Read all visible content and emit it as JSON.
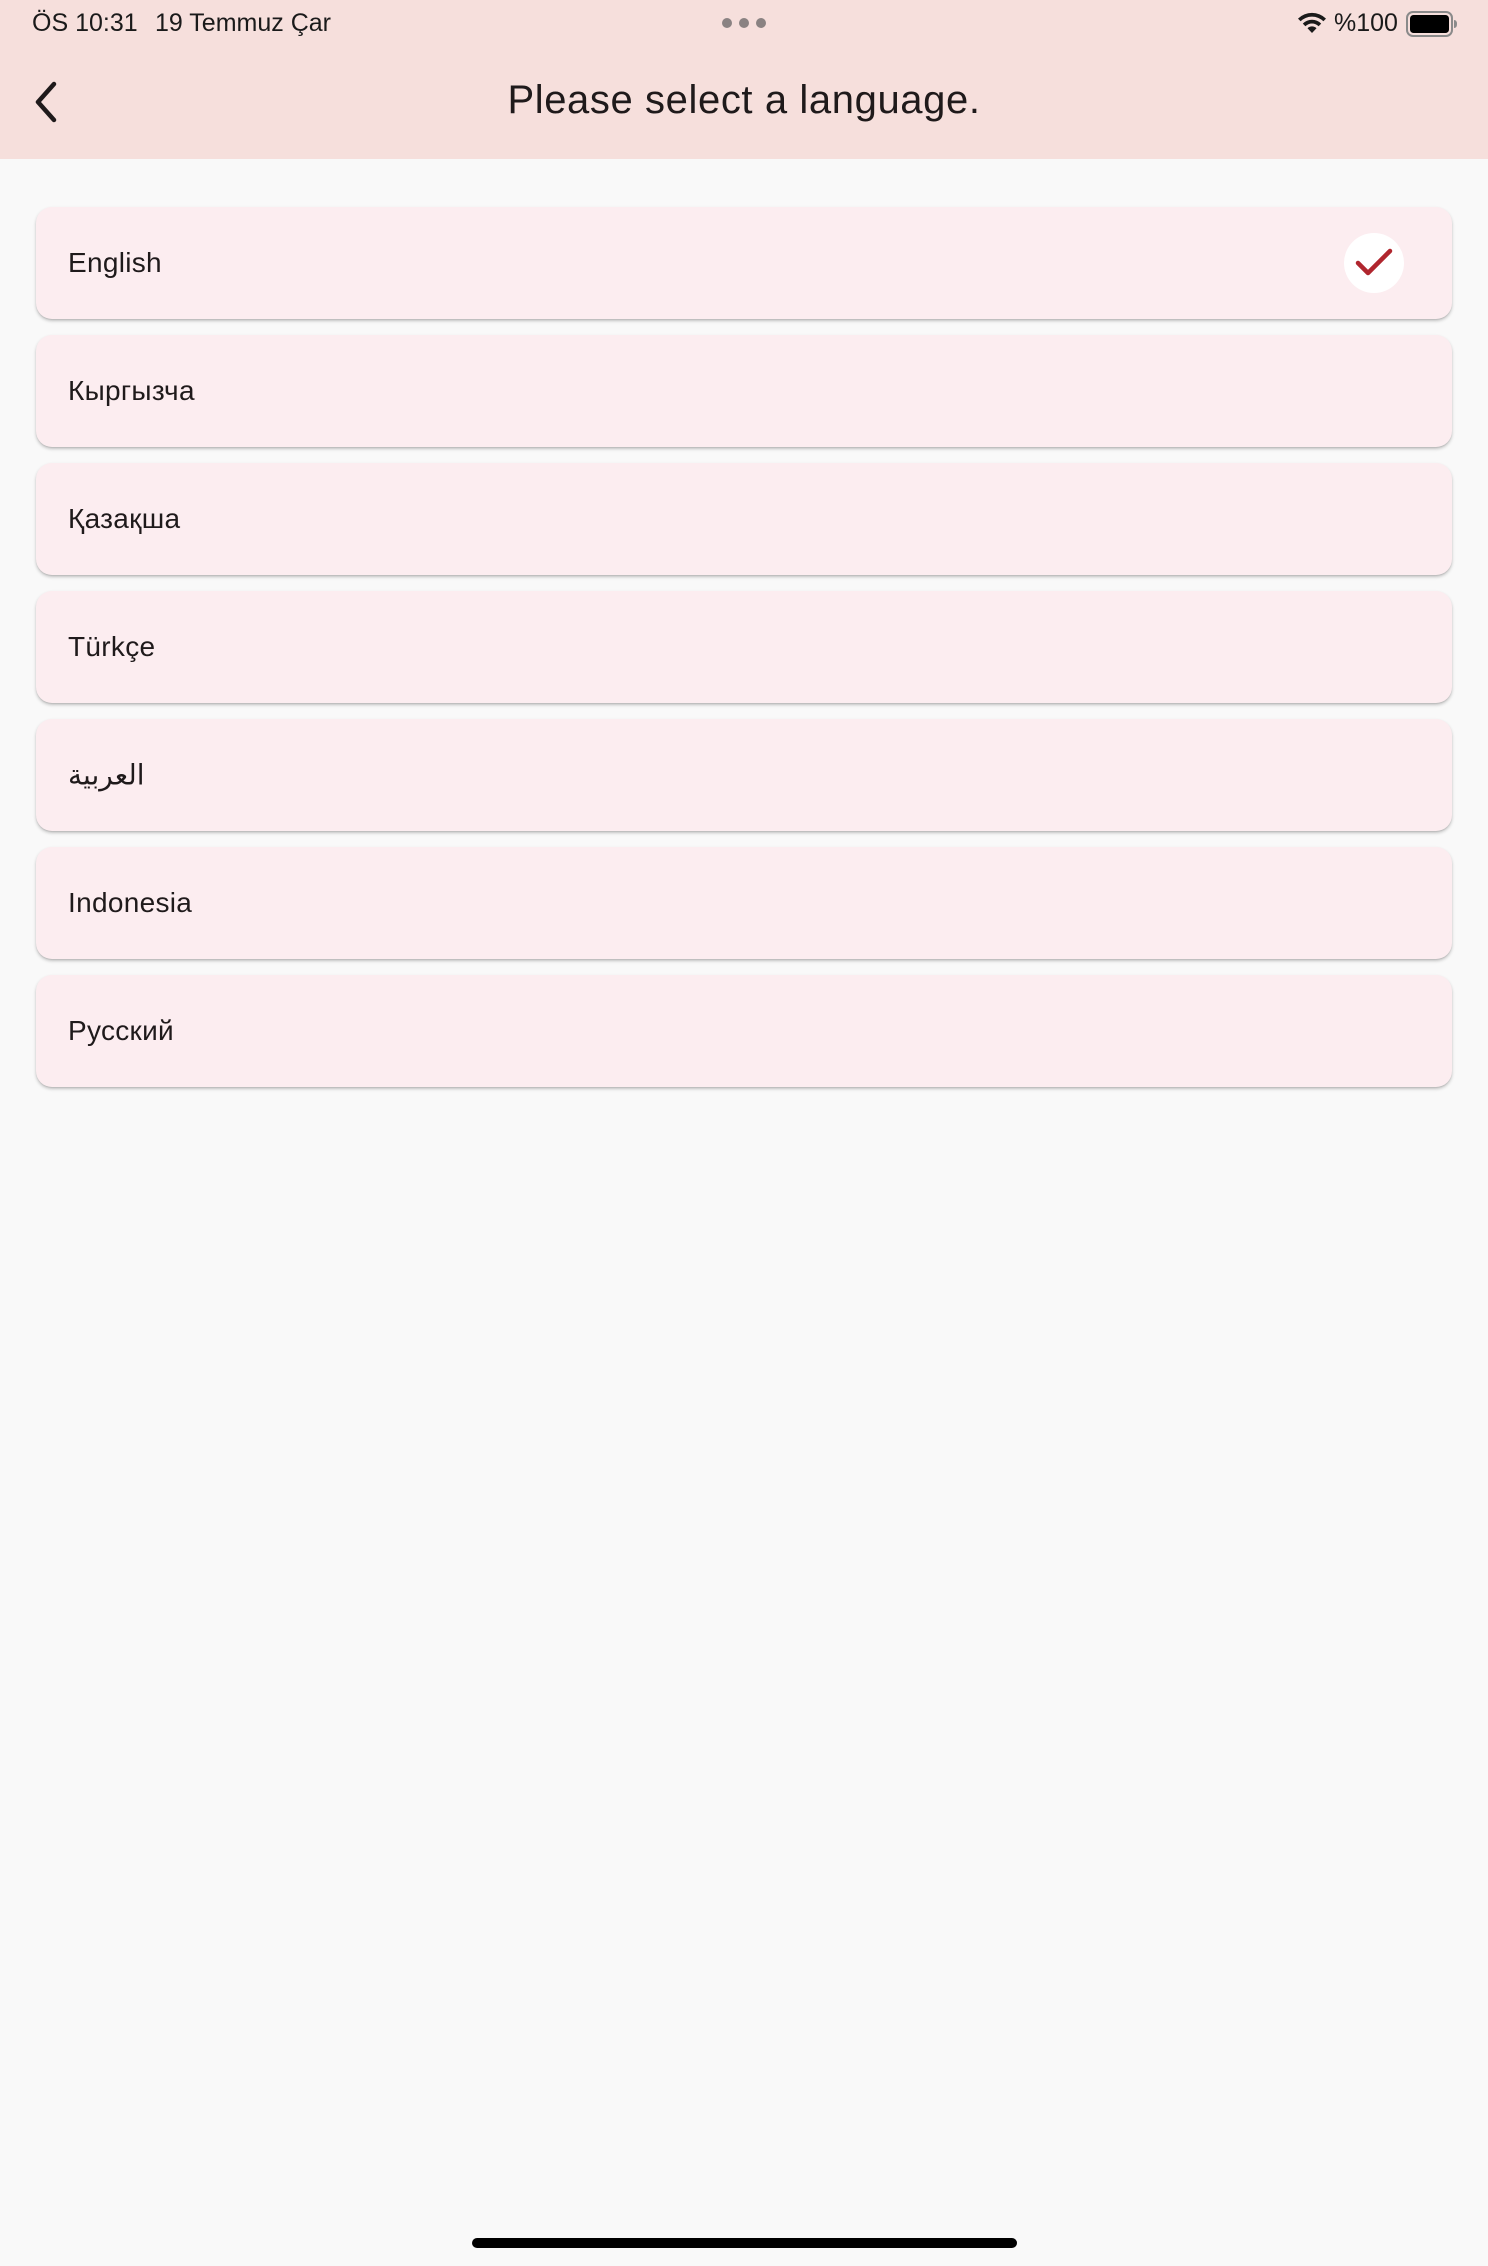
{
  "status_bar": {
    "time": "ÖS 10:31",
    "date": "19 Temmuz Çar",
    "battery_percent": "%100",
    "battery_level": 1.0,
    "icons": [
      "wifi-icon",
      "battery-icon"
    ]
  },
  "header": {
    "title": "Please select a language.",
    "back_icon": "chevron-left-icon"
  },
  "languages": [
    {
      "label": "English",
      "selected": true
    },
    {
      "label": "Кыргызча",
      "selected": false
    },
    {
      "label": "Қазақша",
      "selected": false
    },
    {
      "label": "Türkçe",
      "selected": false
    },
    {
      "label": "العربية",
      "selected": false
    },
    {
      "label": "Indonesia",
      "selected": false
    },
    {
      "label": "Русский",
      "selected": false
    }
  ],
  "colors": {
    "app_bar": "#f6dfdc",
    "background": "#f9f9f9",
    "list_item": "#fcedf0",
    "check_accent": "#b0262e"
  }
}
